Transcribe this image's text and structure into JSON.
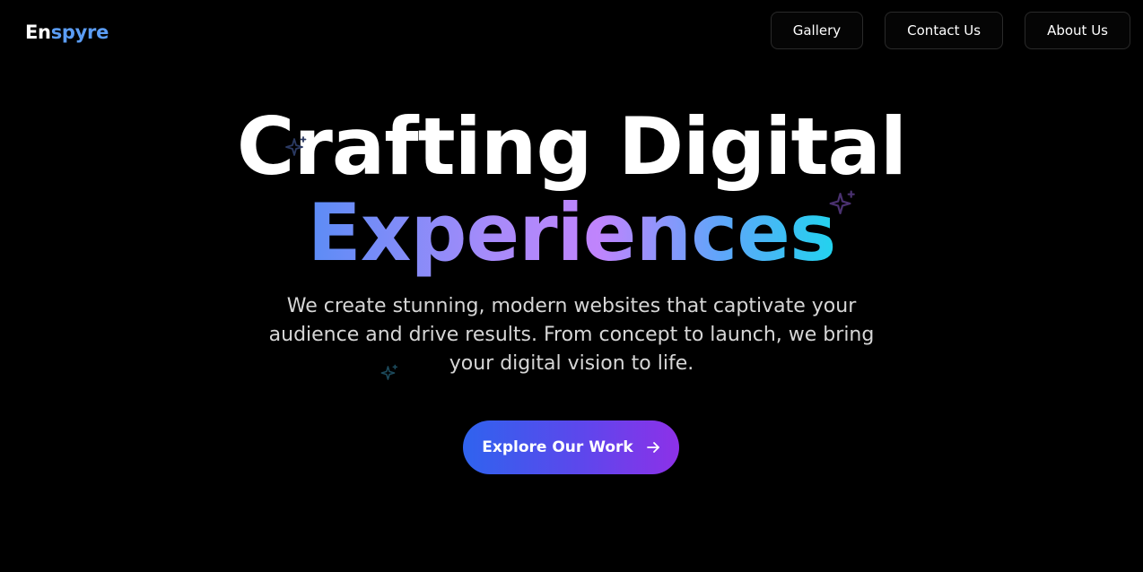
{
  "header": {
    "logo_part1": "En",
    "logo_part2": "spyre",
    "nav": [
      {
        "label": "Gallery"
      },
      {
        "label": "Contact Us"
      },
      {
        "label": "About Us"
      }
    ]
  },
  "hero": {
    "title_line1": "Crafting Digital",
    "title_line2": "Experiences",
    "description_lines": [
      "We create stunning, modern websites that captivate your",
      "audience and drive results. From concept to launch, we bring",
      "your digital vision to life."
    ],
    "cta_label": "Explore Our Work",
    "cta_icon": "arrow-right-icon"
  },
  "decorations": {
    "sparkle_icon": "sparkles-icon",
    "colors": {
      "sparkle_blue": "#2b3a63",
      "sparkle_purple": "#4a3170",
      "sparkle_teal": "#1c4a5c"
    }
  },
  "colors": {
    "background": "#000000",
    "logo_accent": "#5b9df5",
    "gradient_start": "#5b8cf6",
    "gradient_mid": "#c084fc",
    "gradient_end": "#22d3ee",
    "cta_start": "#2f63ee",
    "cta_end": "#8d31e8"
  }
}
